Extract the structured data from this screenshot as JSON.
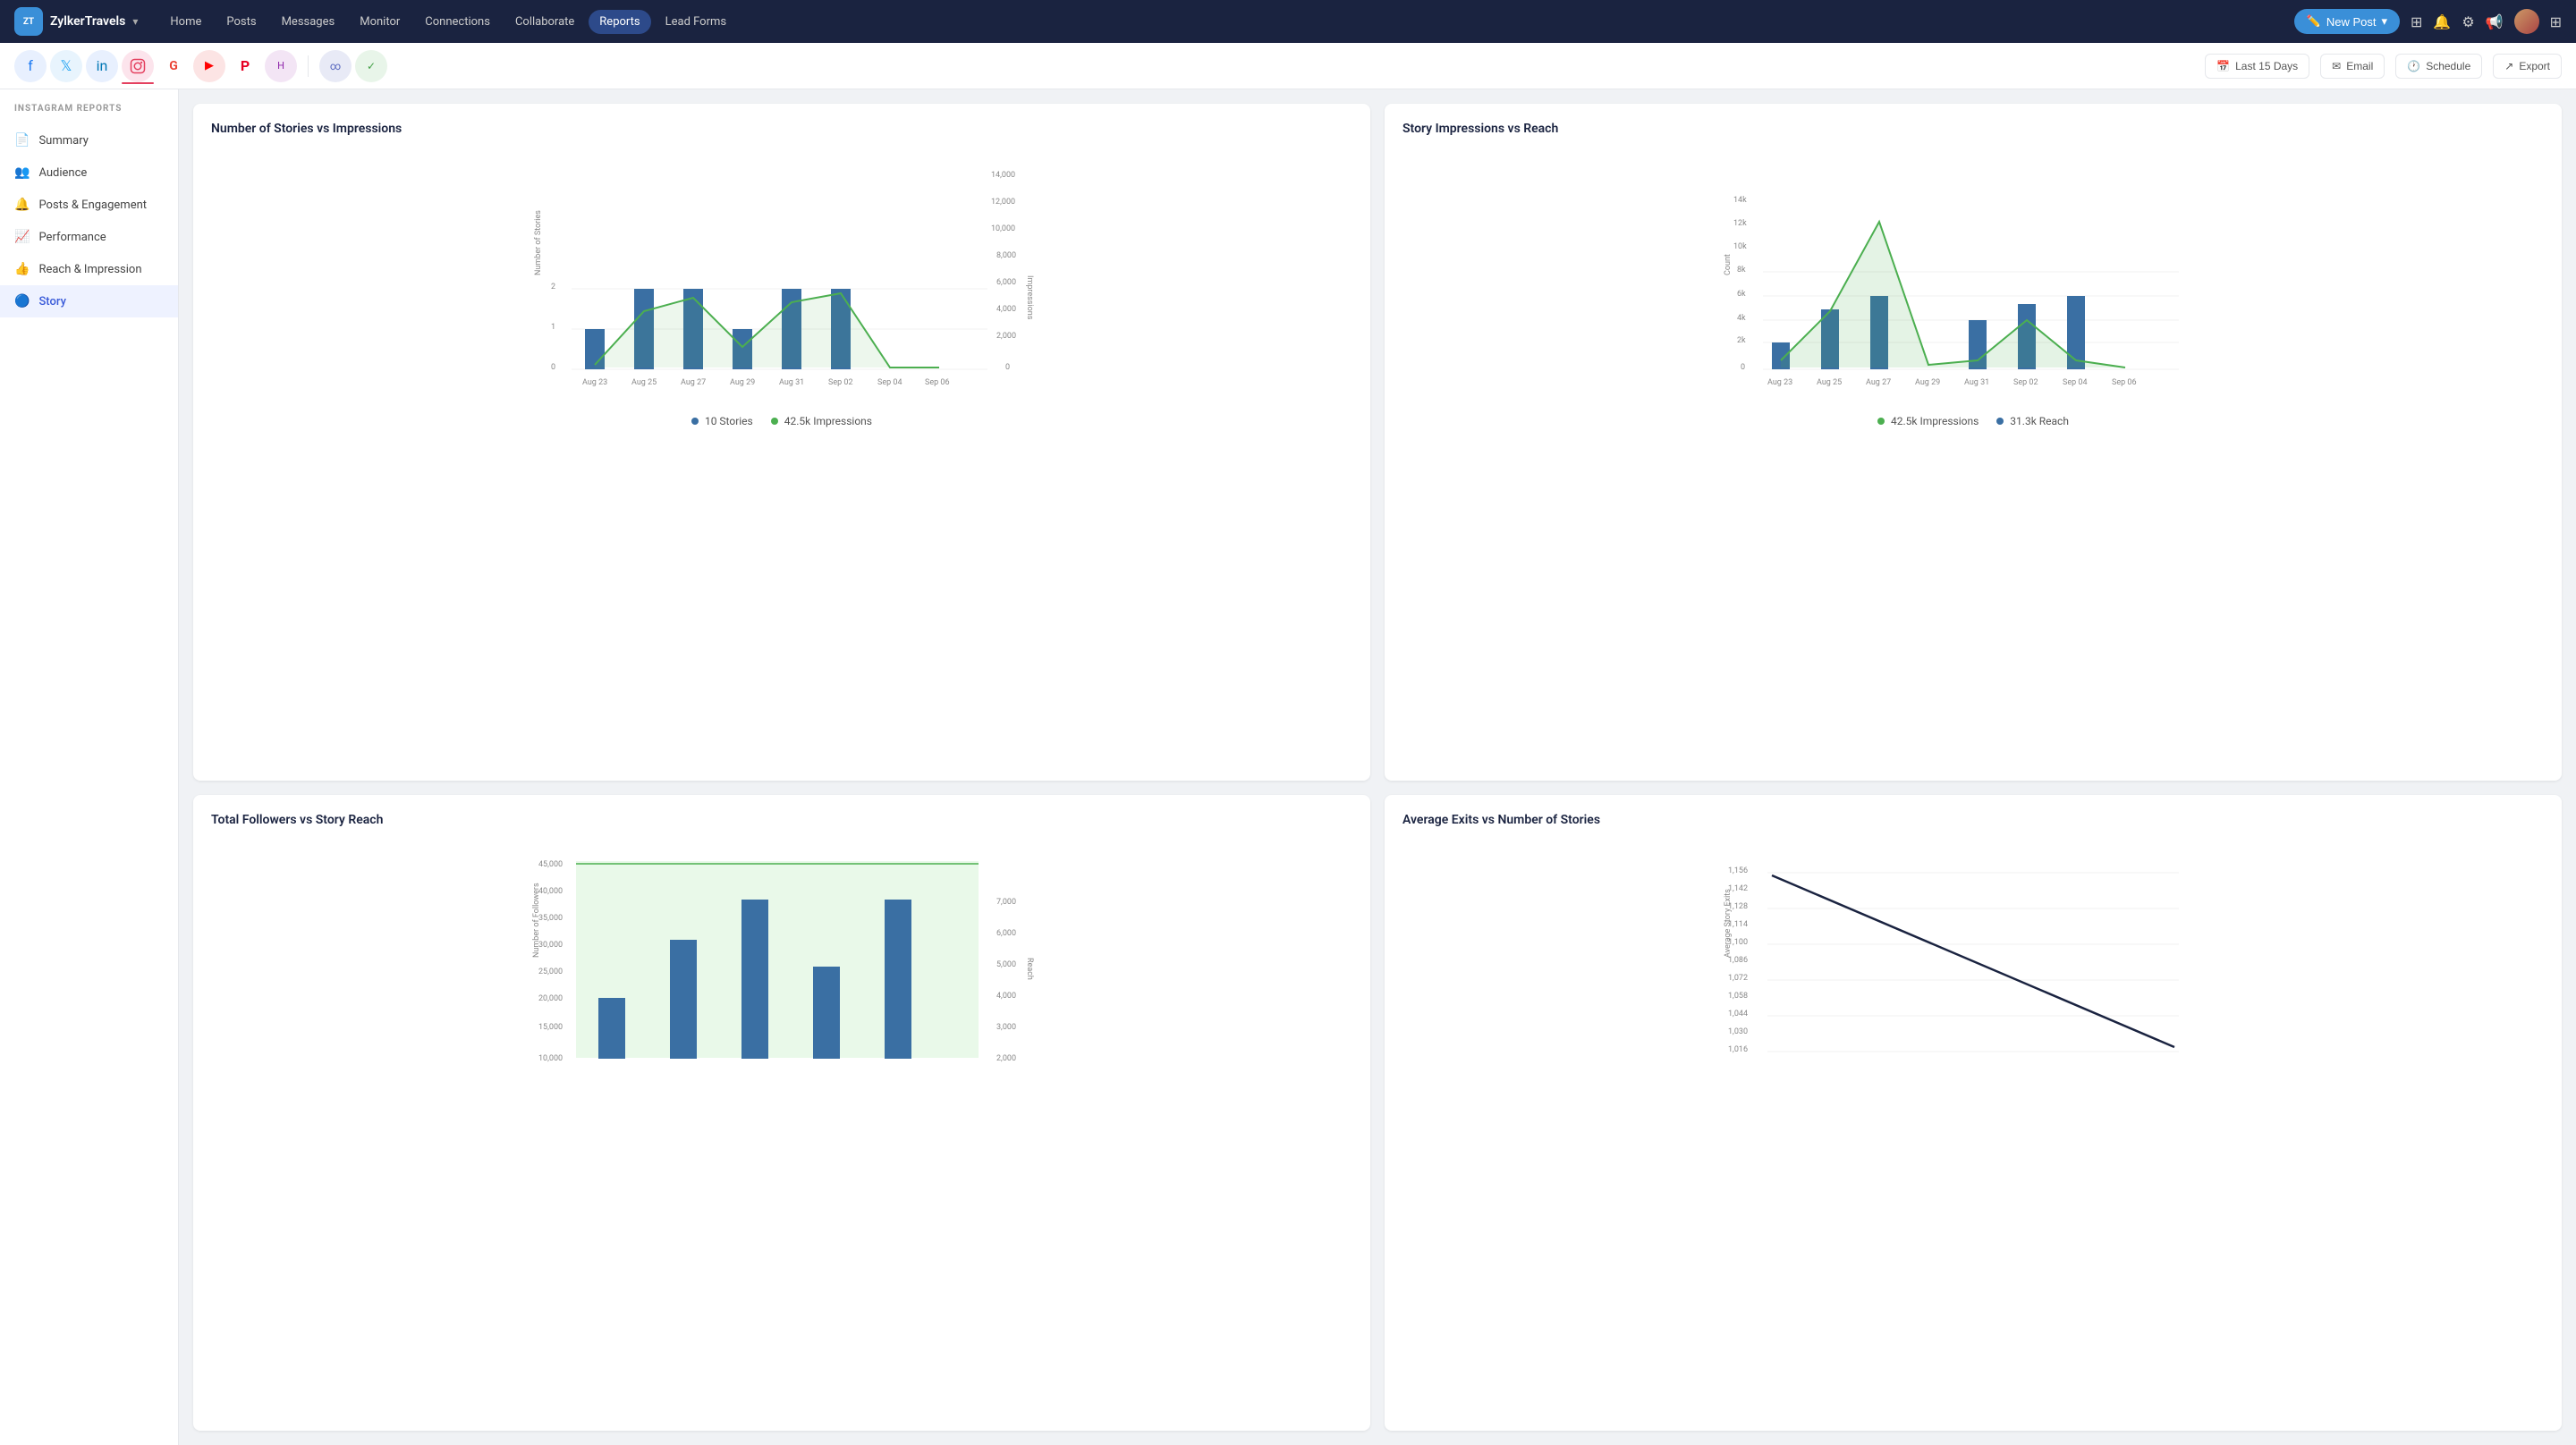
{
  "app": {
    "brand": "ZylkerTravels",
    "logo_initials": "ZT"
  },
  "nav": {
    "links": [
      "Home",
      "Posts",
      "Messages",
      "Monitor",
      "Connections",
      "Collaborate",
      "Reports",
      "Lead Forms"
    ],
    "active": "Reports",
    "new_post_label": "New Post"
  },
  "social_tabs": {
    "platforms": [
      "Facebook",
      "Twitter",
      "LinkedIn",
      "Instagram",
      "Google",
      "YouTube",
      "Pinterest",
      "Hootsuite",
      "Loop",
      "Green"
    ],
    "active": "Instagram"
  },
  "toolbar": {
    "date_range": "Last 15 Days",
    "email_label": "Email",
    "schedule_label": "Schedule",
    "export_label": "Export"
  },
  "sidebar": {
    "section_title": "INSTAGRAM REPORTS",
    "items": [
      {
        "label": "Summary",
        "icon": "📄",
        "active": false
      },
      {
        "label": "Audience",
        "icon": "👥",
        "active": false
      },
      {
        "label": "Posts & Engagement",
        "icon": "🔔",
        "active": false
      },
      {
        "label": "Performance",
        "icon": "📈",
        "active": false
      },
      {
        "label": "Reach & Impression",
        "icon": "👍",
        "active": false
      },
      {
        "label": "Story",
        "icon": "🔵",
        "active": true
      }
    ]
  },
  "charts": {
    "chart1": {
      "title": "Number of Stories vs Impressions",
      "legend": [
        {
          "label": "10 Stories",
          "color": "#3a6fa3"
        },
        {
          "label": "42.5k Impressions",
          "color": "#4caf50"
        }
      ]
    },
    "chart2": {
      "title": "Story Impressions vs Reach",
      "legend": [
        {
          "label": "42.5k Impressions",
          "color": "#4caf50"
        },
        {
          "label": "31.3k Reach",
          "color": "#3a6fa3"
        }
      ]
    },
    "chart3": {
      "title": "Total Followers vs Story Reach",
      "legend": []
    },
    "chart4": {
      "title": "Average Exits vs Number of Stories",
      "legend": []
    }
  }
}
